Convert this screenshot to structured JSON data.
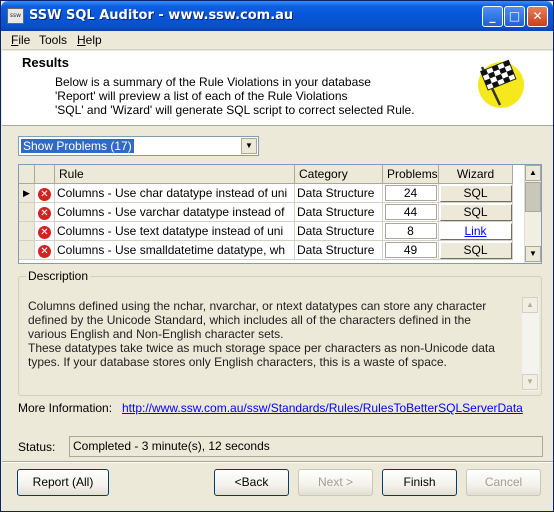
{
  "window": {
    "title": "SSW SQL Auditor - www.ssw.com.au",
    "icon_text": "ssw"
  },
  "menu": [
    {
      "label": "File",
      "mnemonic": "F",
      "rest": "ile"
    },
    {
      "label": "Tools",
      "mnemonic": "",
      "rest": "Tools"
    },
    {
      "label": "Help",
      "mnemonic": "H",
      "rest": "elp"
    }
  ],
  "header": {
    "title": "Results",
    "lines": [
      "Below is a summary of the Rule Violations in your database",
      "'Report' will preview a list of each of the Rule Violations",
      "'SQL' and 'Wizard' will generate SQL script to correct selected Rule."
    ],
    "logo_icon": "checkered-flag-icon"
  },
  "filter": {
    "selected": "Show Problems (17)"
  },
  "grid": {
    "columns": [
      "Rule",
      "Category",
      "Problems",
      "Wizard"
    ],
    "rows": [
      {
        "current": true,
        "rule": "Columns - Use char datatype instead of uni",
        "category": "Data Structure",
        "problems": "24",
        "wizard": "SQL",
        "wizard_link": false
      },
      {
        "current": false,
        "rule": "Columns - Use varchar datatype instead of",
        "category": "Data Structure",
        "problems": "44",
        "wizard": "SQL",
        "wizard_link": false
      },
      {
        "current": false,
        "rule": "Columns - Use text datatype instead of uni",
        "category": "Data Structure",
        "problems": "8",
        "wizard": "Link",
        "wizard_link": true
      },
      {
        "current": false,
        "rule": "Columns - Use smalldatetime datatype, wh",
        "category": "Data Structure",
        "problems": "49",
        "wizard": "SQL",
        "wizard_link": false
      }
    ]
  },
  "description": {
    "legend": "Description",
    "lines": [
      "Columns defined using the nchar, nvarchar, or ntext datatypes can store any character",
      "defined by the Unicode Standard, which includes all of the characters defined in the",
      "various English and Non-English character sets.",
      "These datatypes take twice as much storage space per characters as non-Unicode data",
      "types. If your database stores only English characters, this is a waste of space."
    ]
  },
  "more_info": {
    "label": "More Information:",
    "url": "http://www.ssw.com.au/ssw/Standards/Rules/RulesToBetterSQLServerData"
  },
  "status": {
    "label": "Status:",
    "text": "Completed - 3 minute(s), 12 seconds"
  },
  "buttons": {
    "report": "Report (All)",
    "back": "<Back",
    "next": "Next >",
    "finish": "Finish",
    "cancel": "Cancel"
  },
  "colors": {
    "titlebar": "#0756d8",
    "selection": "#316ac5",
    "error": "#d42121",
    "link": "#0000ff",
    "window_bg": "#ece9d8"
  }
}
